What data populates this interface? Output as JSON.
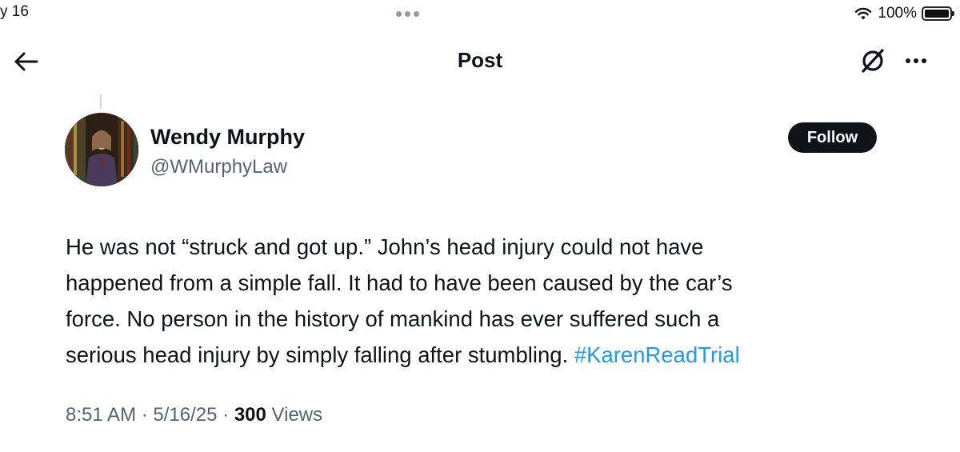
{
  "status_bar": {
    "time": "y 16",
    "battery_percent": "100%"
  },
  "nav": {
    "title": "Post"
  },
  "author": {
    "name": "Wendy Murphy",
    "handle": "@WMurphyLaw",
    "follow_label": "Follow"
  },
  "post": {
    "lines": [
      "He was not “struck and got up.” John’s head injury could not have",
      "happened from a simple fall. It had to have been caused by the car’s",
      "force. No person in the history of mankind has ever suffered such a",
      "serious head injury by simply falling after stumbling. "
    ],
    "hashtag": "#KarenReadTrial"
  },
  "meta": {
    "time": "8:51 AM",
    "separator": "·",
    "date": "5/16/25",
    "views_count": "300",
    "views_label": "Views"
  },
  "colors": {
    "accent": "#1d9bf0",
    "text": "#0f1419",
    "secondary": "#536471"
  },
  "icons": [
    "back-arrow-icon",
    "grok-icon",
    "more-icon",
    "wifi-icon",
    "battery-icon"
  ]
}
